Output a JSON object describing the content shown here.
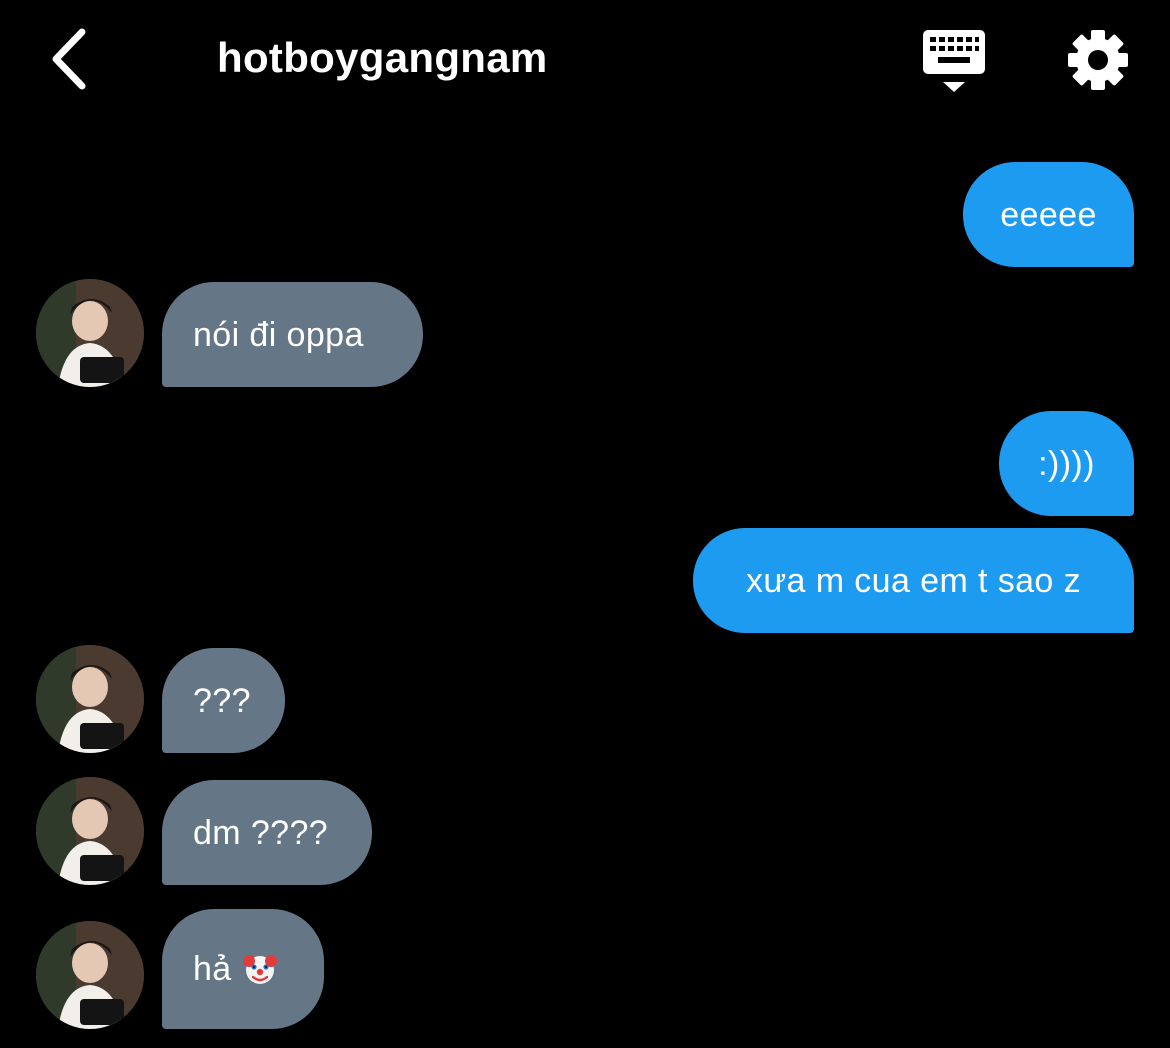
{
  "header": {
    "title": "hotboygangnam"
  },
  "colors": {
    "outgoing_bubble": "#1d9bf0",
    "incoming_bubble": "#657786",
    "background": "#000000"
  },
  "icons": {
    "back": "chevron-left-icon",
    "keyboard": "keyboard-icon",
    "settings": "gear-icon"
  },
  "messages": [
    {
      "direction": "outgoing",
      "text": "eeeee"
    },
    {
      "direction": "incoming",
      "text": "nói đi oppa"
    },
    {
      "direction": "outgoing",
      "text": ":))))"
    },
    {
      "direction": "outgoing",
      "text": "xưa m cua em t sao z"
    },
    {
      "direction": "incoming",
      "text": "???"
    },
    {
      "direction": "incoming",
      "text": "dm ????"
    },
    {
      "direction": "incoming",
      "text": "hả",
      "emoji": "clown-face"
    }
  ]
}
